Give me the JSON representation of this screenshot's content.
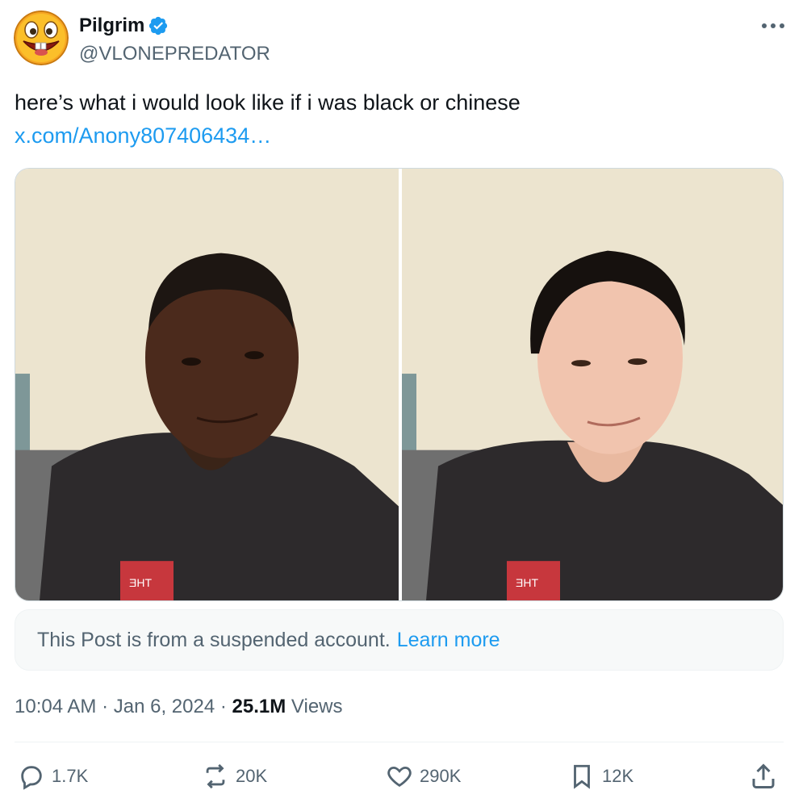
{
  "author": {
    "display_name": "Pilgrim",
    "handle": "@VLONEPREDATOR",
    "verified": true,
    "avatar_icon": "grinning-buck-teeth-emoji",
    "verified_color": "#1d9bf0"
  },
  "post": {
    "text": "here’s what i would look like if i was black or chinese",
    "link_text": "x.com/Anony807406434…",
    "link_color": "#1d9bf0",
    "media": [
      {
        "label": "photo-left",
        "overlay_text": "ƎHT"
      },
      {
        "label": "photo-right",
        "overlay_text": "ƎHT"
      }
    ]
  },
  "notice": {
    "text": "This Post is from a suspended account.",
    "link_label": "Learn more"
  },
  "meta": {
    "time": "10:04 AM",
    "separator": "·",
    "date": "Jan 6, 2024",
    "views_count": "25.1M",
    "views_label": "Views"
  },
  "actions": {
    "replies": "1.7K",
    "reposts": "20K",
    "likes": "290K",
    "bookmarks": "12K"
  },
  "icons": {
    "more": "more-horizontal-icon",
    "reply": "reply-icon",
    "repost": "repost-icon",
    "like": "heart-icon",
    "bookmark": "bookmark-icon",
    "share": "share-icon"
  }
}
